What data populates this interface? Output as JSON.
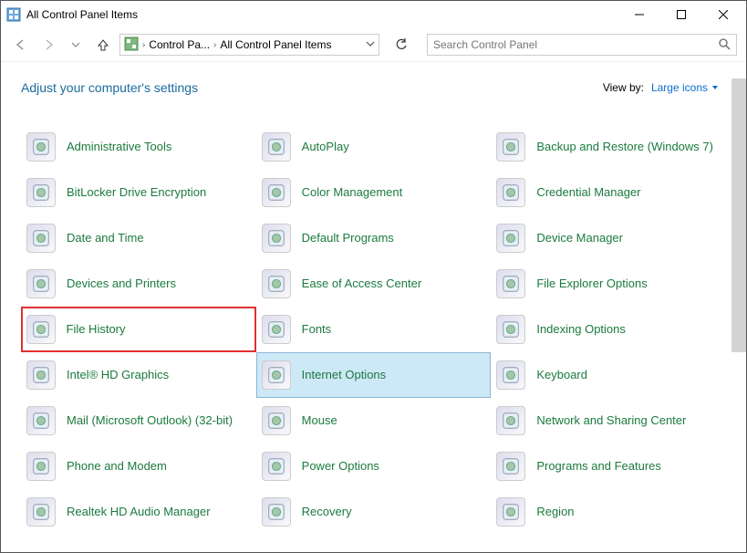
{
  "window": {
    "title": "All Control Panel Items"
  },
  "breadcrumbs": {
    "b1": "Control Pa...",
    "b2": "All Control Panel Items"
  },
  "search": {
    "placeholder": "Search Control Panel"
  },
  "header": {
    "heading": "Adjust your computer's settings",
    "viewby_label": "View by:",
    "viewby_value": "Large icons"
  },
  "items": [
    {
      "label": "Administrative Tools"
    },
    {
      "label": "AutoPlay"
    },
    {
      "label": "Backup and Restore (Windows 7)"
    },
    {
      "label": "BitLocker Drive Encryption"
    },
    {
      "label": "Color Management"
    },
    {
      "label": "Credential Manager"
    },
    {
      "label": "Date and Time"
    },
    {
      "label": "Default Programs"
    },
    {
      "label": "Device Manager"
    },
    {
      "label": "Devices and Printers"
    },
    {
      "label": "Ease of Access Center"
    },
    {
      "label": "File Explorer Options"
    },
    {
      "label": "File History"
    },
    {
      "label": "Fonts"
    },
    {
      "label": "Indexing Options"
    },
    {
      "label": "Intel® HD Graphics"
    },
    {
      "label": "Internet Options"
    },
    {
      "label": "Keyboard"
    },
    {
      "label": "Mail (Microsoft Outlook) (32-bit)"
    },
    {
      "label": "Mouse"
    },
    {
      "label": "Network and Sharing Center"
    },
    {
      "label": "Phone and Modem"
    },
    {
      "label": "Power Options"
    },
    {
      "label": "Programs and Features"
    },
    {
      "label": "Realtek HD Audio Manager"
    },
    {
      "label": "Recovery"
    },
    {
      "label": "Region"
    }
  ],
  "selected_index": 16,
  "highlighted_index": 12
}
